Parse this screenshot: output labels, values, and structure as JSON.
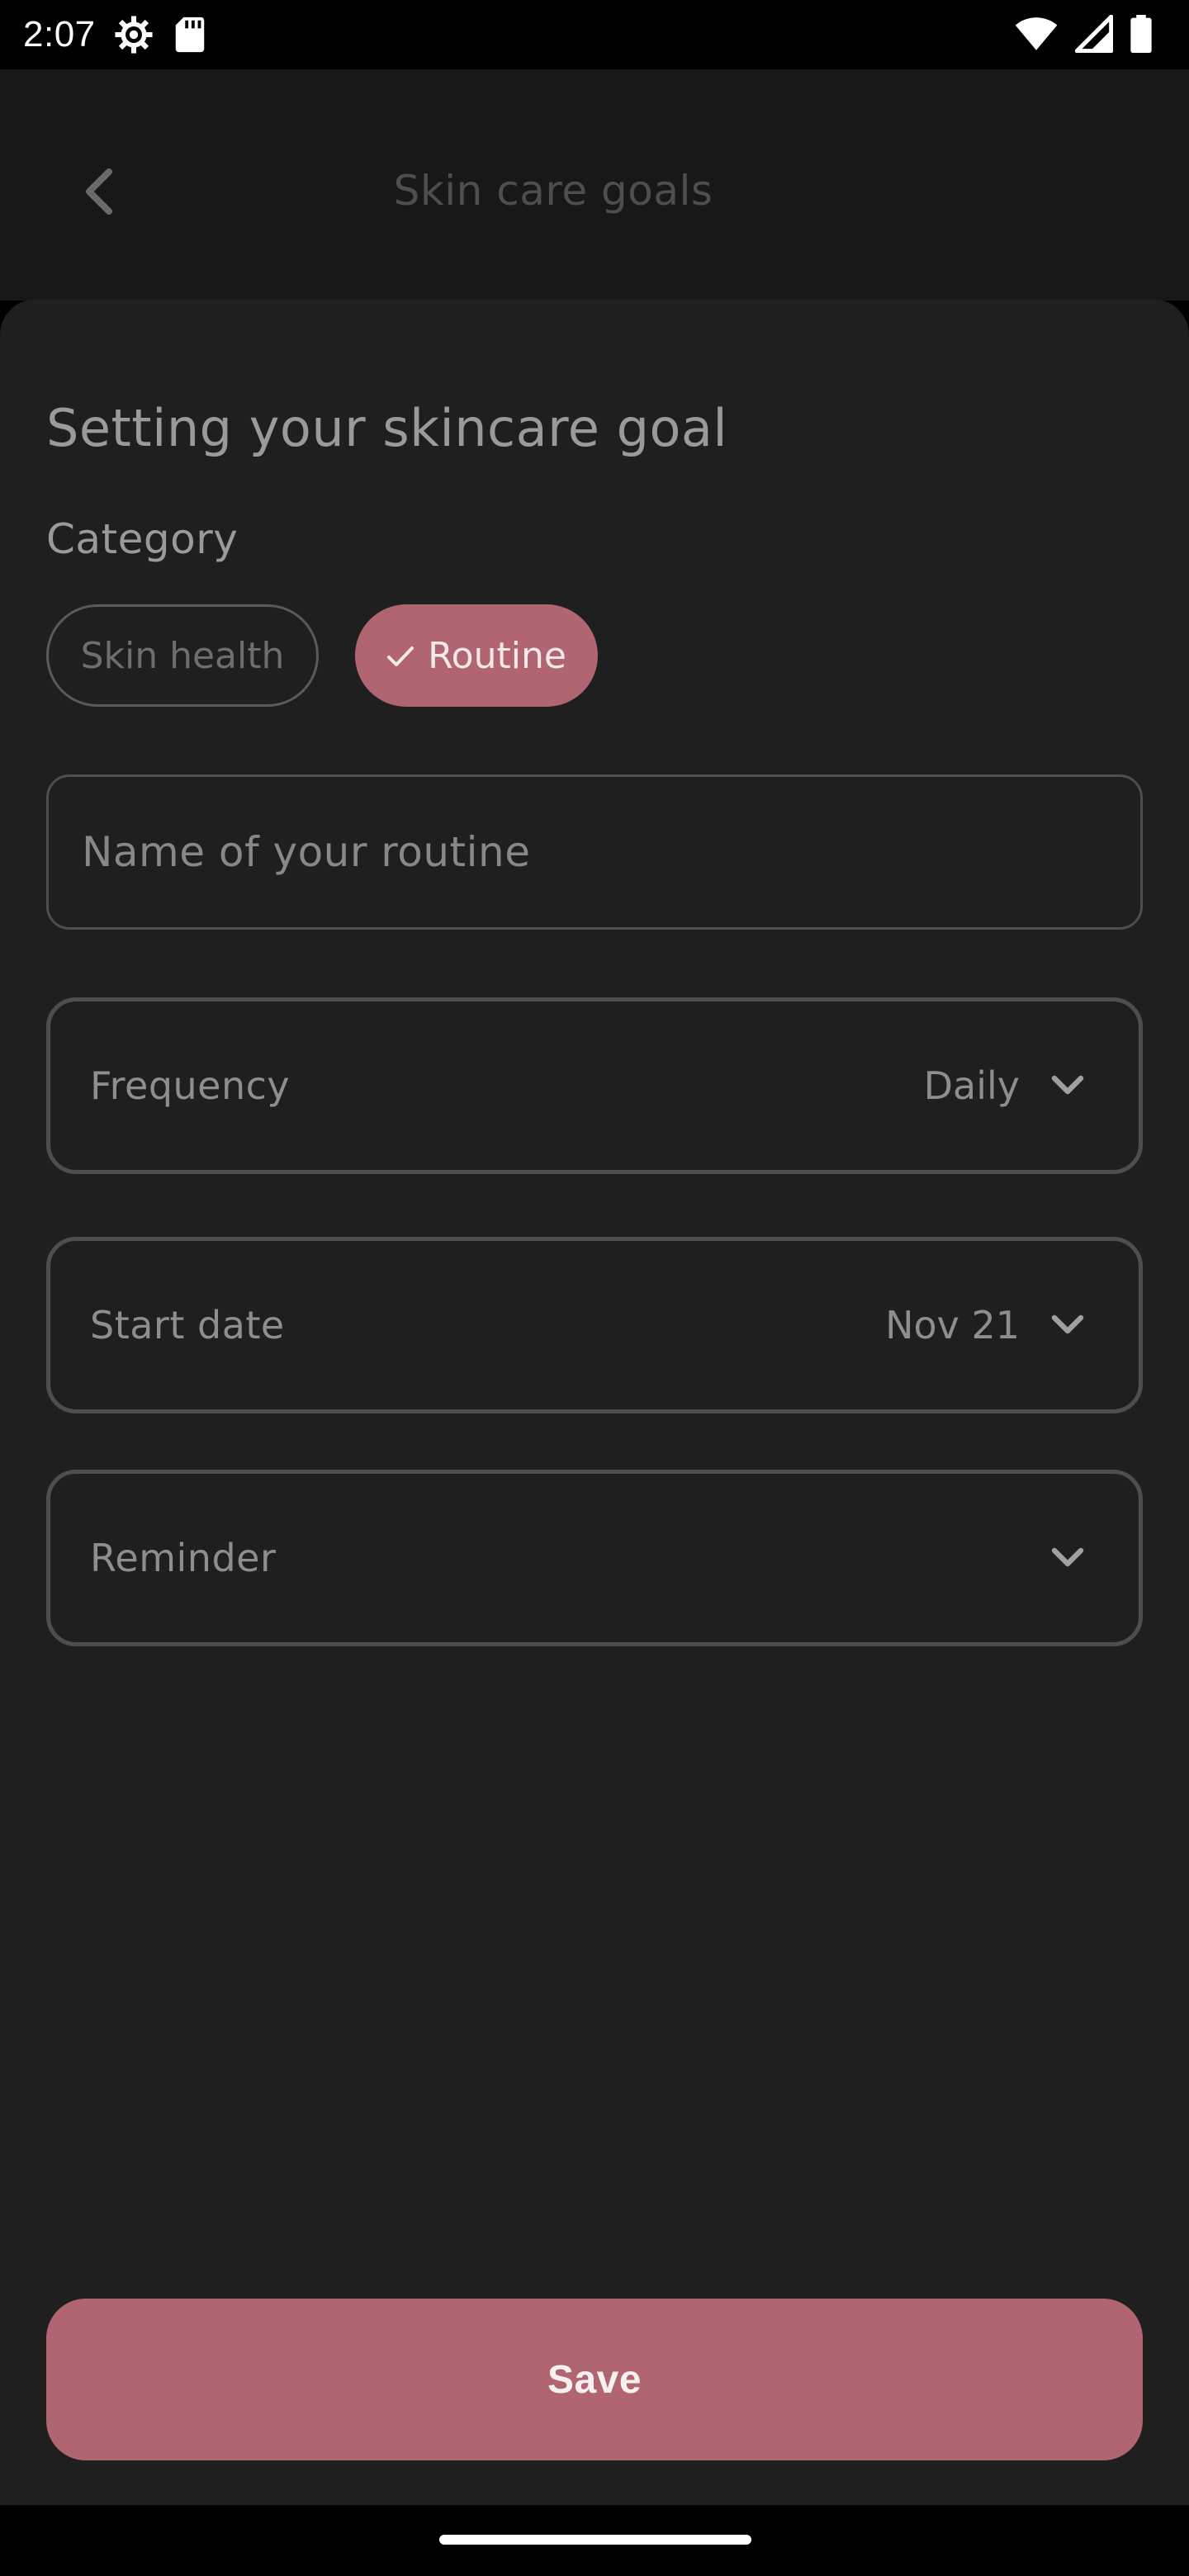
{
  "status_bar": {
    "time": "2:07",
    "left_icons": [
      "settings-icon",
      "sd-card-icon"
    ],
    "right_icons": [
      "wifi-icon",
      "cell-signal-icon",
      "battery-icon"
    ]
  },
  "app_bar": {
    "back_icon": "chevron-left-icon",
    "title": "Skin care goals"
  },
  "form": {
    "heading": "Setting your skincare goal",
    "category_label": "Category",
    "chips": [
      {
        "label": "Skin health",
        "selected": false
      },
      {
        "label": "Routine",
        "selected": true
      }
    ],
    "name_field": {
      "placeholder": "Name of your routine",
      "value": ""
    },
    "frequency": {
      "label": "Frequency",
      "value": "Daily"
    },
    "start_date": {
      "label": "Start date",
      "value": "Nov 21"
    },
    "reminder": {
      "label": "Reminder",
      "value": ""
    },
    "save_label": "Save"
  },
  "colors": {
    "accent": "#b06570",
    "sheet_bg": "#1f1f1f",
    "app_bar_bg": "#181818",
    "border": "#4e4e4e"
  }
}
